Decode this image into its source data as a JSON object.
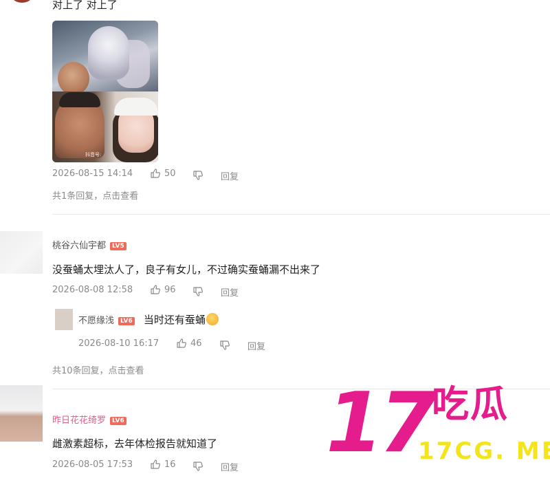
{
  "comment1": {
    "text": "对上了 对上了",
    "image_watermark": "抖音号:",
    "time": "2026-08-15 14:14",
    "likes": "50",
    "reply_label": "回复",
    "replies_summary": "共1条回复，点击查看"
  },
  "comment2": {
    "username": "桃谷六仙宇都",
    "level": "LV5",
    "text": "没蚕蛹太埋汰人了，良子有女儿，不过确实蚕蛹漏不出来了",
    "time": "2026-08-08 12:58",
    "likes": "96",
    "reply_label": "回复",
    "reply": {
      "username": "不愿缘浅",
      "level": "LV6",
      "text": "当时还有蚕蛹",
      "emoji": "grinning-sweat-emoji",
      "time": "2026-08-10 16:17",
      "likes": "46",
      "reply_label": "回复"
    },
    "replies_summary": "共10条回复，点击查看"
  },
  "comment3": {
    "username": "昨日花花绮罗",
    "level": "LV6",
    "text": "雌激素超标，去年体检报告就知道了",
    "time": "2026-08-05 17:53",
    "likes": "16",
    "reply_label": "回复"
  },
  "watermark": {
    "number": "17",
    "chinese": "吃瓜",
    "url": "17CG. ME"
  },
  "colors": {
    "brand_pink": "#e51d8c",
    "brand_yellow": "#f3e51b",
    "level_badge": "#f06a5a",
    "username_highlight": "#e8588c"
  }
}
